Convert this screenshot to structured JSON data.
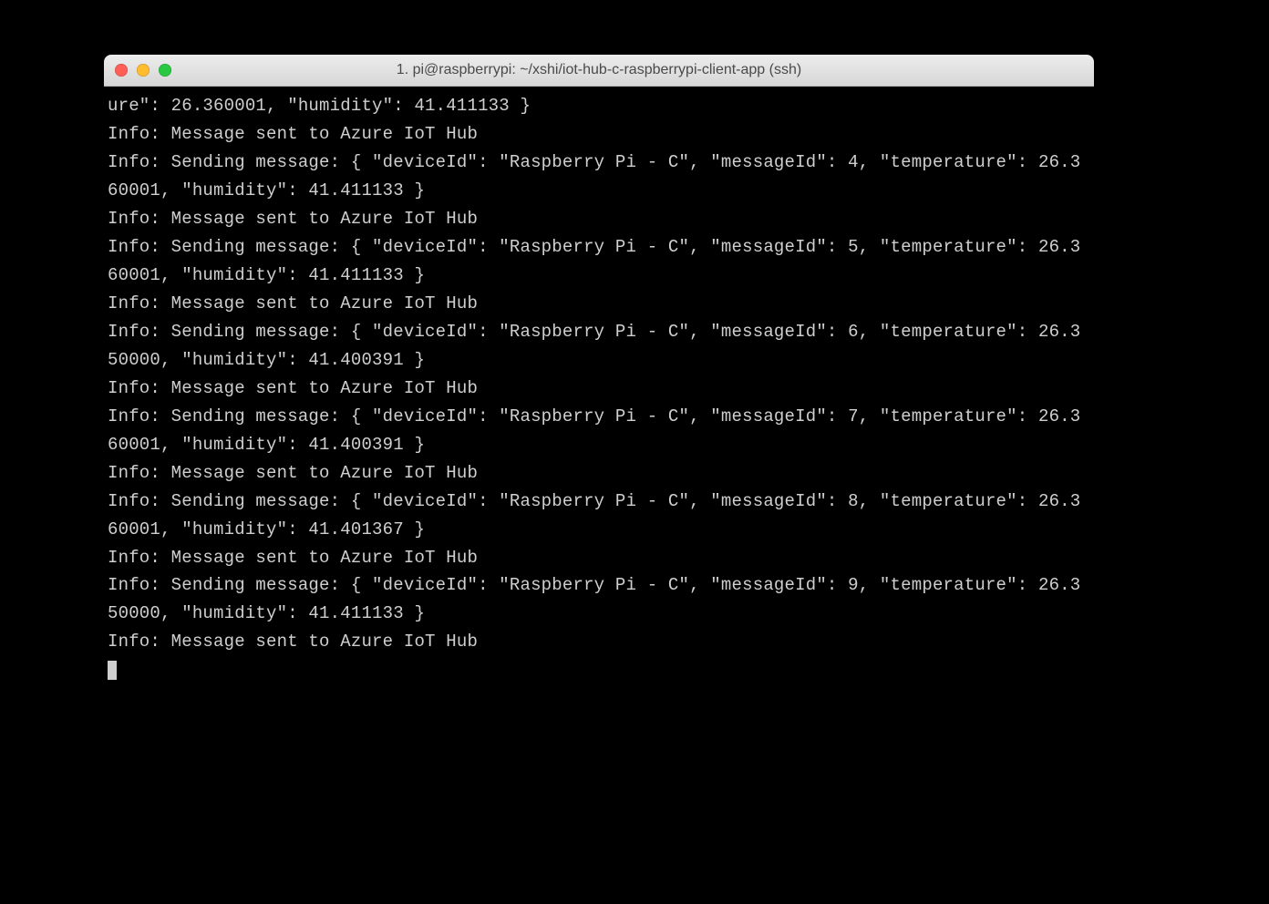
{
  "window": {
    "title": "1. pi@raspberrypi: ~/xshi/iot-hub-c-raspberrypi-client-app (ssh)"
  },
  "terminal": {
    "lines": [
      "ure\": 26.360001, \"humidity\": 41.411133 }",
      "Info: Message sent to Azure IoT Hub",
      "Info: Sending message: { \"deviceId\": \"Raspberry Pi - C\", \"messageId\": 4, \"temperature\": 26.360001, \"humidity\": 41.411133 }",
      "Info: Message sent to Azure IoT Hub",
      "Info: Sending message: { \"deviceId\": \"Raspberry Pi - C\", \"messageId\": 5, \"temperature\": 26.360001, \"humidity\": 41.411133 }",
      "Info: Message sent to Azure IoT Hub",
      "Info: Sending message: { \"deviceId\": \"Raspberry Pi - C\", \"messageId\": 6, \"temperature\": 26.350000, \"humidity\": 41.400391 }",
      "Info: Message sent to Azure IoT Hub",
      "Info: Sending message: { \"deviceId\": \"Raspberry Pi - C\", \"messageId\": 7, \"temperature\": 26.360001, \"humidity\": 41.400391 }",
      "Info: Message sent to Azure IoT Hub",
      "Info: Sending message: { \"deviceId\": \"Raspberry Pi - C\", \"messageId\": 8, \"temperature\": 26.360001, \"humidity\": 41.401367 }",
      "Info: Message sent to Azure IoT Hub",
      "Info: Sending message: { \"deviceId\": \"Raspberry Pi - C\", \"messageId\": 9, \"temperature\": 26.350000, \"humidity\": 41.411133 }",
      "Info: Message sent to Azure IoT Hub"
    ]
  }
}
